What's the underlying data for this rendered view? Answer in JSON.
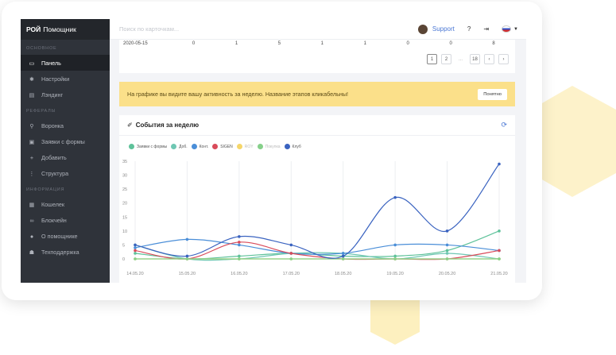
{
  "sidebar": {
    "brand_bold": "РОЙ",
    "brand_rest": "Помощник",
    "sections": [
      {
        "title": "ОСНОВНОЕ",
        "items": [
          {
            "label": "Панель",
            "icon": "monitor-icon",
            "active": true
          },
          {
            "label": "Настройки",
            "icon": "gear-icon"
          },
          {
            "label": "Лэндинг",
            "icon": "browser-icon"
          }
        ]
      },
      {
        "title": "РЕФЕРАЛЫ",
        "items": [
          {
            "label": "Воронка",
            "icon": "funnel-icon"
          },
          {
            "label": "Заявки с формы",
            "icon": "form-icon"
          },
          {
            "label": "Добавить",
            "icon": "add-user-icon"
          },
          {
            "label": "Структура",
            "icon": "structure-icon"
          }
        ]
      },
      {
        "title": "ИНФОРМАЦИЯ",
        "items": [
          {
            "label": "Кошелек",
            "icon": "wallet-icon"
          },
          {
            "label": "Блокчейн",
            "icon": "link-icon"
          },
          {
            "label": "О помощнике",
            "icon": "question-icon"
          },
          {
            "label": "Техподдержка",
            "icon": "support-icon"
          }
        ]
      }
    ]
  },
  "topbar": {
    "search_placeholder": "Поиск по карточкам...",
    "support_label": "Support"
  },
  "table": {
    "last_row": [
      "2020-05-15",
      "0",
      "1",
      "5",
      "1",
      "1",
      "0",
      "0",
      "8"
    ]
  },
  "pagination": {
    "pages": [
      "1",
      "2",
      "...",
      "18"
    ],
    "current": "1",
    "prev": "‹",
    "next": "›"
  },
  "notice": {
    "text": "На графике вы видите вашу активность за неделю. Название этапов кликабельны!",
    "button": "Понятно"
  },
  "chart_card": {
    "title": "События за неделю"
  },
  "chart_data": {
    "type": "line",
    "title": "События за неделю",
    "categories": [
      "14.05.20",
      "15.05.20",
      "16.05.20",
      "17.05.20",
      "18.05.20",
      "19.05.20",
      "20.05.20",
      "21.05.20"
    ],
    "ylim": [
      0,
      35
    ],
    "yticks": [
      0,
      5,
      10,
      15,
      20,
      25,
      30,
      35
    ],
    "grid": "vertical",
    "legend_position": "top-left",
    "series": [
      {
        "name": "Заявки с формы",
        "color": "#5ec29a",
        "values": [
          2,
          0,
          1,
          2,
          1,
          1,
          3,
          10
        ]
      },
      {
        "name": "Доб.",
        "color": "#6fc7b3",
        "values": [
          5,
          0,
          0,
          2,
          2,
          0,
          2,
          0
        ]
      },
      {
        "name": "Конт.",
        "color": "#4a8ed8",
        "values": [
          4,
          7,
          5,
          2,
          2,
          5,
          5,
          3
        ]
      },
      {
        "name": "SIGEN",
        "color": "#d94b5a",
        "values": [
          3,
          0,
          6,
          2,
          0,
          0,
          0,
          3
        ]
      },
      {
        "name": "ROY",
        "color": "#f5d66a",
        "values": [
          0,
          0,
          0,
          0,
          0,
          0,
          0,
          0
        ]
      },
      {
        "name": "Покупка",
        "color": "#86d08a",
        "values": [
          0,
          0,
          0,
          0,
          0,
          0,
          0,
          0
        ]
      },
      {
        "name": "Клуб",
        "color": "#3a63c0",
        "values": [
          5,
          1,
          8,
          5,
          1,
          22,
          10,
          34
        ]
      }
    ]
  },
  "colors": {
    "sidebar_bg": "#2f333a",
    "accent": "#4a77d4",
    "notice_bg": "#fbe08a"
  }
}
